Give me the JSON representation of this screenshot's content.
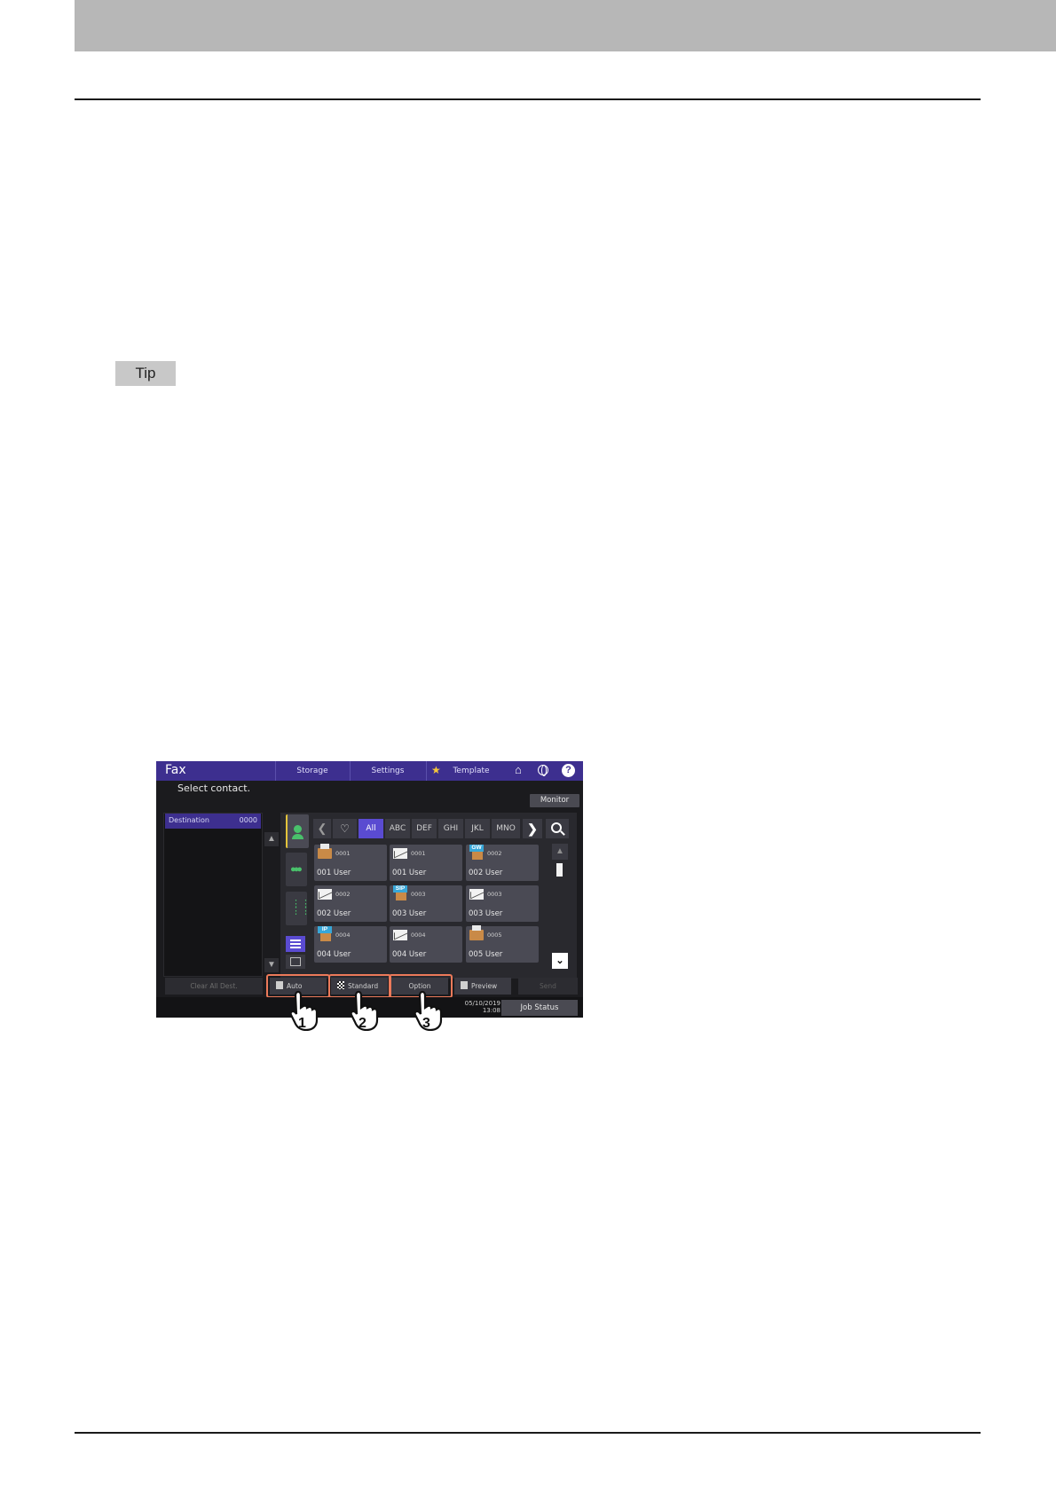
{
  "tip_label": "Tip",
  "panel": {
    "app_title": "Fax",
    "top_tabs": [
      "Storage",
      "Settings",
      "Template"
    ],
    "prompt": "Select contact.",
    "monitor_label": "Monitor",
    "destination_label": "Destination",
    "destination_count": "0000",
    "index_tabs": [
      "All",
      "ABC",
      "DEF",
      "GHI",
      "JKL",
      "MNO"
    ],
    "active_index": "All",
    "cards": [
      {
        "icon": "fax-icon",
        "num": "0001",
        "name": "001 User"
      },
      {
        "icon": "email-icon",
        "num": "0001",
        "name": "001 User"
      },
      {
        "icon": "gw-fax-icon",
        "badge": "GW",
        "num": "0002",
        "name": "002 User"
      },
      {
        "icon": "email-icon",
        "num": "0002",
        "name": "002 User"
      },
      {
        "icon": "sip-fax-icon",
        "badge": "SIP",
        "num": "0003",
        "name": "003 User"
      },
      {
        "icon": "email-icon",
        "num": "0003",
        "name": "003 User"
      },
      {
        "icon": "ip-fax-icon",
        "badge": "IP",
        "num": "0004",
        "name": "004 User"
      },
      {
        "icon": "email-icon",
        "num": "0004",
        "name": "004 User"
      },
      {
        "icon": "fax-icon",
        "num": "0005",
        "name": "005 User"
      }
    ],
    "buttons": {
      "clear": "Clear All Dest.",
      "auto": "Auto",
      "standard": "Standard",
      "option": "Option",
      "preview": "Preview",
      "send": "Send"
    },
    "date": "05/10/2019",
    "time": "13:08",
    "job_status": "Job Status"
  },
  "callouts": [
    "1",
    "2",
    "3"
  ],
  "colors": {
    "topbar": "#3d2f8f",
    "accent": "#5a4bd1",
    "highlight": "#ec7a5a",
    "icon_green": "#49c16b"
  }
}
